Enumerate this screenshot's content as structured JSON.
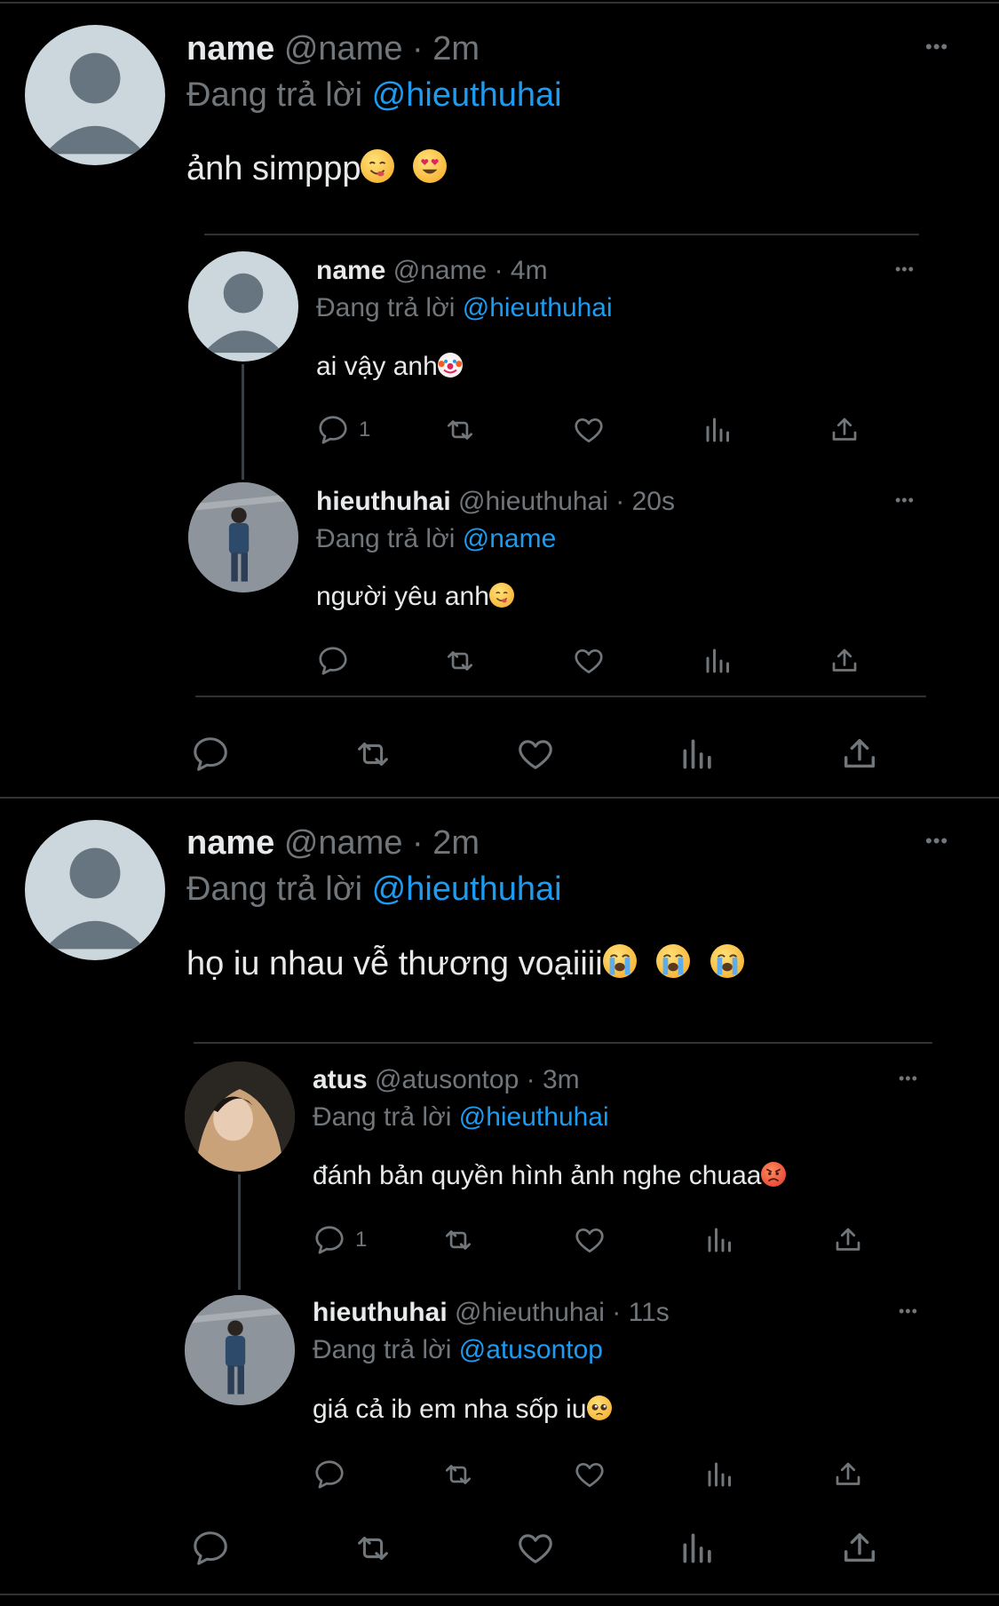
{
  "tweets": [
    {
      "name": "name",
      "handle": "@name",
      "time": "2m",
      "reply_prefix": "Đang trả lời",
      "reply_to": "@hieuthuhai",
      "text": "ảnh simppp",
      "replies": [
        {
          "name": "name",
          "handle": "@name",
          "time": "4m",
          "reply_prefix": "Đang trả lời",
          "reply_to": "@hieuthuhai",
          "text": "ai vậy anh",
          "reply_count": "1"
        },
        {
          "name": "hieuthuhai",
          "handle": "@hieuthuhai",
          "time": "20s",
          "reply_prefix": "Đang trả lời",
          "reply_to": "@name",
          "text": "người yêu anh",
          "reply_count": ""
        }
      ]
    },
    {
      "name": "name",
      "handle": "@name",
      "time": "2m",
      "reply_prefix": "Đang trả lời",
      "reply_to": "@hieuthuhai",
      "text": "họ iu nhau vễ thương voạiiii",
      "replies": [
        {
          "name": "atus",
          "handle": "@atusontop",
          "time": "3m",
          "reply_prefix": "Đang trả lời",
          "reply_to": "@hieuthuhai",
          "text": "đánh bản quyền hình ảnh nghe chuaa",
          "reply_count": "1"
        },
        {
          "name": "hieuthuhai",
          "handle": "@hieuthuhai",
          "time": "11s",
          "reply_prefix": "Đang trả lời",
          "reply_to": "@atusontop",
          "text": "giá cả ib em nha sốp iu",
          "reply_count": ""
        }
      ]
    }
  ],
  "more_label": "•••",
  "dot": "·",
  "colors": {
    "background": "#000000",
    "mention": "#1d9bf0",
    "muted": "#71767b",
    "text": "#e7e9ea"
  },
  "icons": [
    "reply-icon",
    "retweet-icon",
    "like-icon",
    "views-icon",
    "share-icon",
    "more-icon"
  ]
}
